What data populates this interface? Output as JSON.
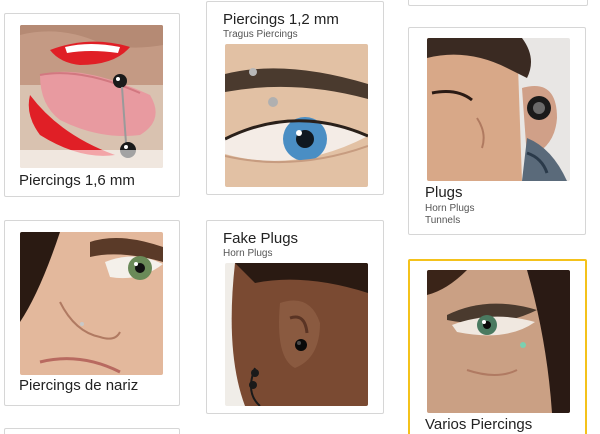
{
  "categories": [
    {
      "title": "Piercings 1,6 mm",
      "subtitles": []
    },
    {
      "title": "Piercings 1,2 mm",
      "subtitles": [
        "Tragus Piercings"
      ]
    },
    {
      "title": "Plugs",
      "subtitles": [
        "Horn Plugs",
        "Tunnels"
      ]
    },
    {
      "title": "Piercings de nariz",
      "subtitles": []
    },
    {
      "title": "Fake Plugs",
      "subtitles": [
        "Horn Plugs"
      ]
    },
    {
      "title": "Varios Piercings",
      "subtitles": []
    }
  ],
  "colors": {
    "card_border": "#d6d6d6",
    "selected_border": "#f4c21b",
    "title_text": "#222222",
    "subtitle_text": "#555555"
  }
}
